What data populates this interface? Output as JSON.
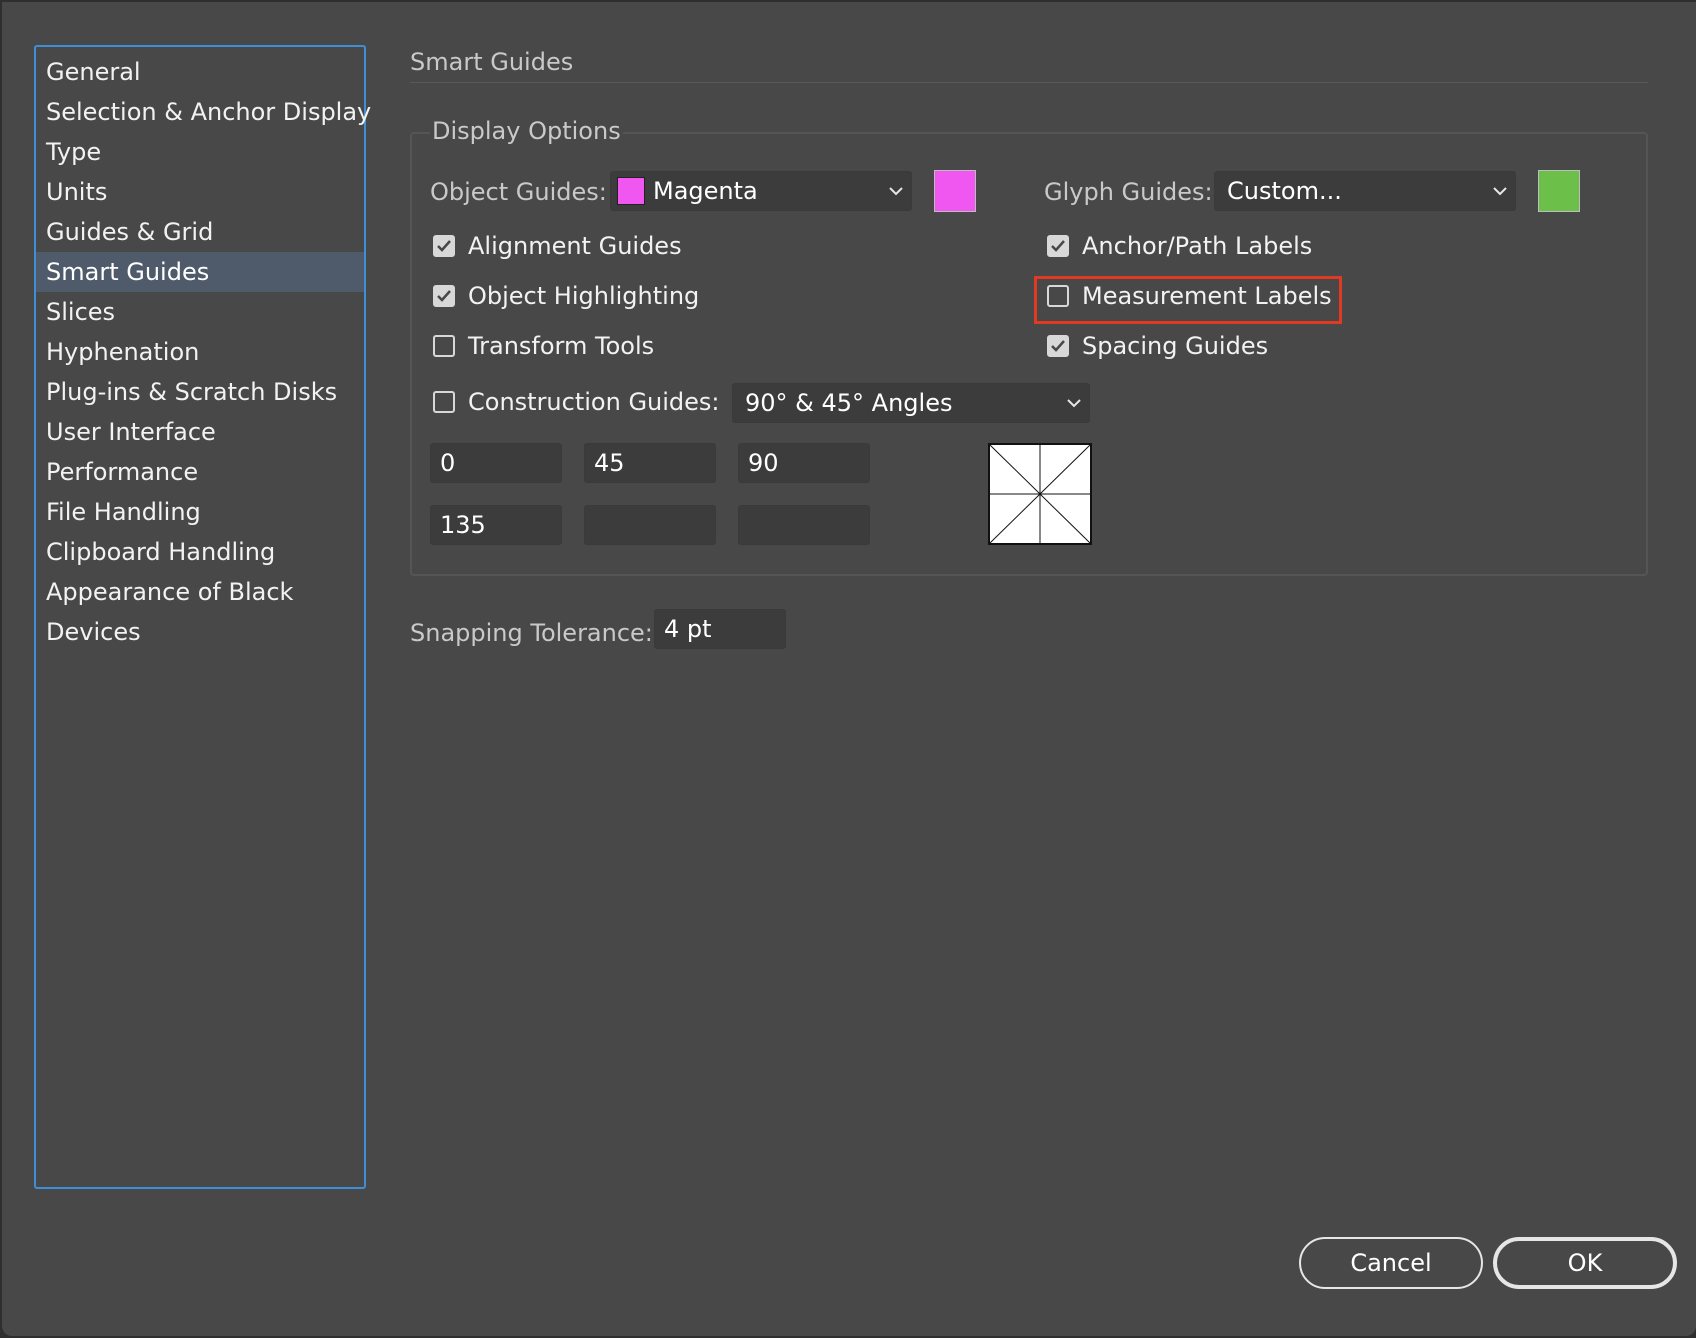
{
  "sidebar": {
    "items": [
      {
        "label": "General"
      },
      {
        "label": "Selection & Anchor Display"
      },
      {
        "label": "Type"
      },
      {
        "label": "Units"
      },
      {
        "label": "Guides & Grid"
      },
      {
        "label": "Smart Guides",
        "selected": true
      },
      {
        "label": "Slices"
      },
      {
        "label": "Hyphenation"
      },
      {
        "label": "Plug-ins & Scratch Disks"
      },
      {
        "label": "User Interface"
      },
      {
        "label": "Performance"
      },
      {
        "label": "File Handling"
      },
      {
        "label": "Clipboard Handling"
      },
      {
        "label": "Appearance of Black"
      },
      {
        "label": "Devices"
      }
    ]
  },
  "main": {
    "title": "Smart Guides",
    "display_options": {
      "title": "Display Options",
      "object_guides": {
        "label": "Object Guides:",
        "value": "Magenta",
        "color": "#f056f0"
      },
      "glyph_guides": {
        "label": "Glyph Guides:",
        "value": "Custom...",
        "color": "#6cc04a"
      },
      "checkboxes": {
        "alignment_guides": {
          "label": "Alignment Guides",
          "checked": true
        },
        "object_highlighting": {
          "label": "Object Highlighting",
          "checked": true
        },
        "transform_tools": {
          "label": "Transform Tools",
          "checked": false
        },
        "anchor_path_labels": {
          "label": "Anchor/Path Labels",
          "checked": true
        },
        "measurement_labels": {
          "label": "Measurement Labels",
          "checked": false
        },
        "spacing_guides": {
          "label": "Spacing Guides",
          "checked": true
        }
      },
      "construction_guides": {
        "label": "Construction Guides:",
        "checked": false,
        "value": "90° & 45° Angles"
      },
      "angles": [
        "0",
        "45",
        "90",
        "135",
        "",
        ""
      ]
    },
    "snapping": {
      "label": "Snapping Tolerance:",
      "value": "4 pt"
    }
  },
  "buttons": {
    "cancel": "Cancel",
    "ok": "OK"
  },
  "colors": {
    "highlight": "#e13a22",
    "sidebar_border": "#3d8fd6",
    "selection": "#4f5b6b"
  }
}
